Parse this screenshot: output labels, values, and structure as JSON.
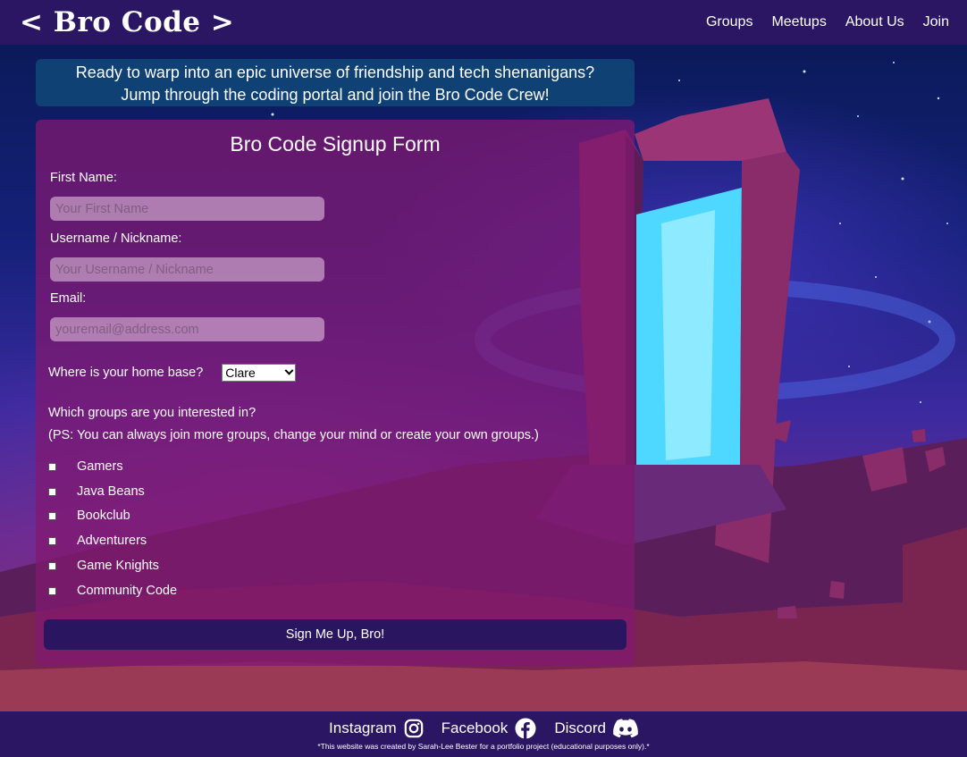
{
  "header": {
    "logo": "< Bro Code >",
    "nav": [
      "Groups",
      "Meetups",
      "About Us",
      "Join"
    ]
  },
  "banner": {
    "line1": "Ready to warp into an epic universe of friendship and tech shenanigans?",
    "line2": "Jump through the coding portal and join the Bro Code Crew!"
  },
  "form": {
    "title": "Bro Code Signup Form",
    "first_name_label": "First Name:",
    "first_name_placeholder": "Your First Name",
    "username_label": "Username / Nickname:",
    "username_placeholder": "Your Username / Nickname",
    "email_label": "Email:",
    "email_placeholder": "youremail@address.com",
    "home_base_label": "Where is your home base?",
    "home_base_selected": "Clare",
    "groups_question": "Which groups are you interested in?",
    "groups_note": "(PS: You can always join more groups, change your mind or create your own groups.)",
    "groups": [
      "Gamers",
      "Java Beans",
      "Bookclub",
      "Adventurers",
      "Game Knights",
      "Community Code"
    ],
    "submit_label": "Sign Me Up, Bro!"
  },
  "footer": {
    "social": [
      {
        "label": "Instagram",
        "icon": "instagram-icon"
      },
      {
        "label": "Facebook",
        "icon": "facebook-icon"
      },
      {
        "label": "Discord",
        "icon": "discord-icon"
      }
    ],
    "credit": "*This website was created by Sarah-Lee Bester for a portfolio project (educational purposes only).*"
  }
}
